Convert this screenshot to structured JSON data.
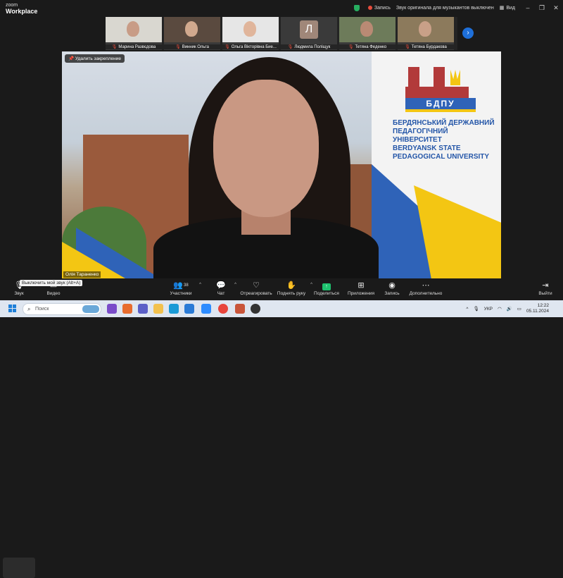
{
  "app": {
    "logo_line1": "zoom",
    "logo_line2": "Workplace"
  },
  "titlebar": {
    "recording_label": "Запись",
    "sound_status": "Звук оригинала для музыкантов выключен",
    "view_label": "Вид",
    "minimize": "–",
    "maximize": "❐",
    "close": "✕"
  },
  "participants_strip": [
    {
      "name": "Марина Развєдова",
      "kind": "video",
      "face": "#c89c86",
      "bg": "#d9d7d0"
    },
    {
      "name": "Винник Ольга",
      "kind": "video",
      "face": "#d1a98e",
      "bg": "#5a4a3f"
    },
    {
      "name": "Ольга Вікторівна Бие...",
      "kind": "video",
      "face": "#e0b59b",
      "bg": "#e6e6e6"
    },
    {
      "name": "Людмила Поліщук",
      "kind": "avatar",
      "initial": "Л"
    },
    {
      "name": "Тетяна Феденко",
      "kind": "video",
      "face": "#b98a74",
      "bg": "#6d7b5a"
    },
    {
      "name": "Тетяна Бурдакова",
      "kind": "video",
      "face": "#c9a088",
      "bg": "#8c7a5c"
    }
  ],
  "next_button": "›",
  "main_video": {
    "unpin_label": "Удалить закрепление",
    "participant_name": "Олія Тараненко",
    "emblem_text": "БДПУ",
    "university_lines": [
      "БЕРДЯНСЬКИЙ ДЕРЖАВНИЙ",
      "ПЕДАГОГІЧНИЙ УНІВЕРСИТЕТ",
      "BERDYANSK STATE",
      "PEDAGOGICAL UNIVERSITY"
    ]
  },
  "toolbar": {
    "tooltip": "Выключить мой звук (Alt+A)",
    "audio": "Звук",
    "video": "Видео",
    "participants": "Участники",
    "participants_count": "38",
    "chat": "Чат",
    "react": "Отреагировать",
    "raise_hand": "Поднять руку",
    "share": "Поделиться",
    "apps": "Приложения",
    "record": "Запись",
    "more": "Дополнительно",
    "leave": "Выйти"
  },
  "taskbar": {
    "search_placeholder": "Поиск",
    "language": "УКР",
    "time": "12:22",
    "date": "05.11.2024"
  },
  "colors": {
    "accent_blue": "#1e6fd9",
    "share_green": "#1ec26f",
    "record_red": "#e74c3c",
    "ua_blue": "#2f63b8",
    "ua_yellow": "#f3c613"
  }
}
